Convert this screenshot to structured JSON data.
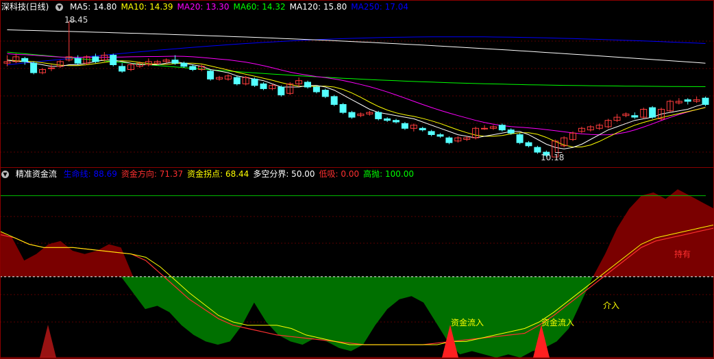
{
  "main_header": {
    "title": "深科技(日线)",
    "ma": [
      {
        "label": "MA5: 14.80",
        "color": "#ffffff"
      },
      {
        "label": "MA10: 14.39",
        "color": "#ffff00"
      },
      {
        "label": "MA20: 13.30",
        "color": "#ff00ff"
      },
      {
        "label": "MA60: 14.32",
        "color": "#00ff00"
      },
      {
        "label": "MA120: 15.80",
        "color": "#ffffff"
      },
      {
        "label": "MA250: 17.04",
        "color": "#0000ff"
      }
    ]
  },
  "sub_header": {
    "title": "精准资金流",
    "items": [
      {
        "label": "生命线: 88.69",
        "color": "#0000ff"
      },
      {
        "label": "资金方向: 71.37",
        "color": "#ff3030"
      },
      {
        "label": "资金拐点: 68.44",
        "color": "#ffff00"
      },
      {
        "label": "多空分界: 50.00",
        "color": "#ffffff"
      },
      {
        "label": "低吸: 0.00",
        "color": "#ff3030"
      },
      {
        "label": "高抛: 100.00",
        "color": "#00ff00"
      }
    ]
  },
  "annotations": {
    "high": "18.45",
    "low": "10.18",
    "signal1": "资金流入",
    "signal2": "资金流入",
    "buy": "介入",
    "hold": "持有"
  },
  "colors": {
    "up": "#ff3c3c",
    "down": "#54ffff",
    "ma5": "#ffffff",
    "ma10": "#ffff00",
    "ma20": "#ff00ff",
    "ma60": "#00ff00",
    "ma120": "#ffffff",
    "ma250": "#0000ff",
    "area_pos": "#7a0000",
    "area_neg": "#007000"
  },
  "chart_data": [
    {
      "type": "candlestick",
      "title": "深科技(日线)",
      "ylim": [
        9.6,
        19.0
      ],
      "candles": [
        [
          15.8,
          15.9,
          16.3,
          15.6
        ],
        [
          15.9,
          16.2,
          16.4,
          15.8
        ],
        [
          16.1,
          15.9,
          16.2,
          15.7
        ],
        [
          15.8,
          15.2,
          15.9,
          15.1
        ],
        [
          15.2,
          15.4,
          15.5,
          15.1
        ],
        [
          15.5,
          15.5,
          15.7,
          15.3
        ],
        [
          15.6,
          15.9,
          16.0,
          15.5
        ],
        [
          16.0,
          16.2,
          18.45,
          15.9
        ],
        [
          16.1,
          15.8,
          16.3,
          15.7
        ],
        [
          15.8,
          16.2,
          16.3,
          15.7
        ],
        [
          16.2,
          15.9,
          16.4,
          15.8
        ],
        [
          16.0,
          16.3,
          16.5,
          15.9
        ],
        [
          16.3,
          15.7,
          16.4,
          15.6
        ],
        [
          15.6,
          15.3,
          15.8,
          15.2
        ],
        [
          15.4,
          15.7,
          15.8,
          15.3
        ],
        [
          15.6,
          15.8,
          15.9,
          15.5
        ],
        [
          15.7,
          15.9,
          16.1,
          15.6
        ],
        [
          15.8,
          15.9,
          16.0,
          15.7
        ],
        [
          15.9,
          16.0,
          16.1,
          15.8
        ],
        [
          16.0,
          15.8,
          16.3,
          15.7
        ],
        [
          15.8,
          15.6,
          15.9,
          15.5
        ],
        [
          15.6,
          15.4,
          15.7,
          15.3
        ],
        [
          15.4,
          15.6,
          15.7,
          15.3
        ],
        [
          15.3,
          14.8,
          15.4,
          14.7
        ],
        [
          14.8,
          14.9,
          15.0,
          14.7
        ],
        [
          14.8,
          15.0,
          15.1,
          14.7
        ],
        [
          14.9,
          14.5,
          15.0,
          14.4
        ],
        [
          14.5,
          14.9,
          15.0,
          14.4
        ],
        [
          14.8,
          14.4,
          14.9,
          14.3
        ],
        [
          14.5,
          14.2,
          14.6,
          14.1
        ],
        [
          14.2,
          14.4,
          14.5,
          14.1
        ],
        [
          14.3,
          13.8,
          14.4,
          13.7
        ],
        [
          13.9,
          14.5,
          14.6,
          13.8
        ],
        [
          14.5,
          14.7,
          14.9,
          14.3
        ],
        [
          14.6,
          14.3,
          14.7,
          14.2
        ],
        [
          14.3,
          14.0,
          14.4,
          13.9
        ],
        [
          14.1,
          13.7,
          14.2,
          13.6
        ],
        [
          13.7,
          13.2,
          13.8,
          13.1
        ],
        [
          13.2,
          12.7,
          13.3,
          12.6
        ],
        [
          12.7,
          12.4,
          12.8,
          12.3
        ],
        [
          12.5,
          12.6,
          12.7,
          12.4
        ],
        [
          12.6,
          12.7,
          12.8,
          12.5
        ],
        [
          12.7,
          12.3,
          12.8,
          12.2
        ],
        [
          12.3,
          12.2,
          12.4,
          12.1
        ],
        [
          12.2,
          12.1,
          12.3,
          12.0
        ],
        [
          12.0,
          11.7,
          12.1,
          11.6
        ],
        [
          11.7,
          11.9,
          12.0,
          11.5
        ],
        [
          11.7,
          11.6,
          11.8,
          11.5
        ],
        [
          11.5,
          11.3,
          11.6,
          11.2
        ],
        [
          11.3,
          11.2,
          11.4,
          11.1
        ],
        [
          11.1,
          10.8,
          11.2,
          10.7
        ],
        [
          10.9,
          11.1,
          11.2,
          10.8
        ],
        [
          11.0,
          11.1,
          11.2,
          10.9
        ],
        [
          11.1,
          11.7,
          11.8,
          11.0
        ],
        [
          11.7,
          11.7,
          11.9,
          11.6
        ],
        [
          11.7,
          11.8,
          11.9,
          11.6
        ],
        [
          11.9,
          11.6,
          12.0,
          11.5
        ],
        [
          11.6,
          11.4,
          11.7,
          11.3
        ],
        [
          11.3,
          10.8,
          11.4,
          10.7
        ],
        [
          10.8,
          10.6,
          10.9,
          10.5
        ],
        [
          10.5,
          10.2,
          10.6,
          10.1
        ],
        [
          10.2,
          10.0,
          10.3,
          9.9
        ],
        [
          9.9,
          10.9,
          11.0,
          10.18
        ],
        [
          10.6,
          11.1,
          11.2,
          10.5
        ],
        [
          11.0,
          11.4,
          11.5,
          10.9
        ],
        [
          11.5,
          11.7,
          11.8,
          11.4
        ],
        [
          11.6,
          11.8,
          11.9,
          11.5
        ],
        [
          11.7,
          11.9,
          12.0,
          11.6
        ],
        [
          11.8,
          12.2,
          12.3,
          11.7
        ],
        [
          12.2,
          12.4,
          12.6,
          12.1
        ],
        [
          12.5,
          12.6,
          12.7,
          12.4
        ],
        [
          12.5,
          12.4,
          12.7,
          12.3
        ],
        [
          12.4,
          12.9,
          13.0,
          12.3
        ],
        [
          13.0,
          12.4,
          13.1,
          12.3
        ],
        [
          12.3,
          12.9,
          13.0,
          12.2
        ],
        [
          12.8,
          13.4,
          13.5,
          12.7
        ],
        [
          13.3,
          13.4,
          13.6,
          13.2
        ],
        [
          13.5,
          13.4,
          13.6,
          13.2
        ],
        [
          13.4,
          13.5,
          13.7,
          13.3
        ],
        [
          13.6,
          13.2,
          13.7,
          13.1
        ]
      ],
      "ma_series": [
        {
          "name": "MA5",
          "values": [
            16.0,
            15.9,
            15.9,
            15.8,
            15.7,
            15.6,
            15.6,
            15.7,
            15.7,
            15.8,
            15.9,
            16.0,
            16.0,
            15.9,
            15.8,
            15.7,
            15.7,
            15.7,
            15.8,
            15.9,
            15.8,
            15.7,
            15.6,
            15.4,
            15.3,
            15.2,
            15.0,
            14.9,
            14.8,
            14.7,
            14.5,
            14.3,
            14.3,
            14.3,
            14.4,
            14.4,
            14.3,
            14.1,
            13.8,
            13.5,
            13.2,
            12.9,
            12.7,
            12.6,
            12.5,
            12.4,
            12.3,
            12.1,
            11.9,
            11.7,
            11.5,
            11.3,
            11.2,
            11.1,
            11.2,
            11.3,
            11.4,
            11.5,
            11.5,
            11.3,
            11.0,
            10.7,
            10.5,
            10.4,
            10.5,
            10.7,
            11.0,
            11.3,
            11.6,
            11.8,
            12.0,
            12.2,
            12.3,
            12.4,
            12.6,
            12.7,
            12.8,
            12.9,
            13.1,
            13.25
          ]
        }
      ],
      "annotations": {
        "high": 18.45,
        "low": 10.18
      }
    },
    {
      "type": "area",
      "title": "精准资金流",
      "ylim": [
        0,
        110
      ],
      "baseline": 50,
      "series": [
        {
          "name": "生命线",
          "values": [
            78,
            74,
            60,
            64,
            70,
            72,
            66,
            64,
            66,
            70,
            68,
            40,
            30,
            32,
            28,
            20,
            14,
            10,
            8,
            10,
            20,
            34,
            22,
            14,
            10,
            8,
            12,
            10,
            6,
            4,
            8,
            20,
            30,
            36,
            38,
            34,
            22,
            10,
            2,
            4,
            2,
            0,
            2,
            0,
            4,
            6,
            10,
            18,
            34,
            50,
            64,
            80,
            92,
            100,
            102,
            98,
            104,
            100,
            96,
            92
          ]
        },
        {
          "name": "资金方向",
          "values": [
            76,
            74,
            70,
            68,
            68,
            68,
            67,
            66,
            65,
            64,
            60,
            52,
            44,
            36,
            30,
            24,
            20,
            18,
            16,
            14,
            13,
            12,
            11,
            10,
            9,
            8,
            8,
            8,
            8,
            8,
            9,
            10,
            11,
            12,
            13,
            14,
            15,
            20,
            26,
            33,
            40,
            47,
            54,
            61,
            68,
            72,
            74,
            76,
            78,
            80
          ]
        },
        {
          "name": "资金拐点",
          "values": [
            78,
            74,
            70,
            68,
            68,
            68,
            67,
            66,
            65,
            64,
            62,
            56,
            48,
            40,
            33,
            26,
            22,
            20,
            20,
            20,
            18,
            14,
            12,
            10,
            8,
            8,
            8,
            8,
            8,
            8,
            8,
            10,
            10,
            12,
            14,
            16,
            18,
            22,
            28,
            35,
            42,
            49,
            56,
            63,
            70,
            74,
            76,
            78,
            80,
            82
          ]
        }
      ],
      "reference_lines": [
        {
          "name": "多空分界",
          "value": 50
        },
        {
          "name": "高抛",
          "value": 100
        },
        {
          "name": "低吸",
          "value": 0
        }
      ]
    }
  ]
}
